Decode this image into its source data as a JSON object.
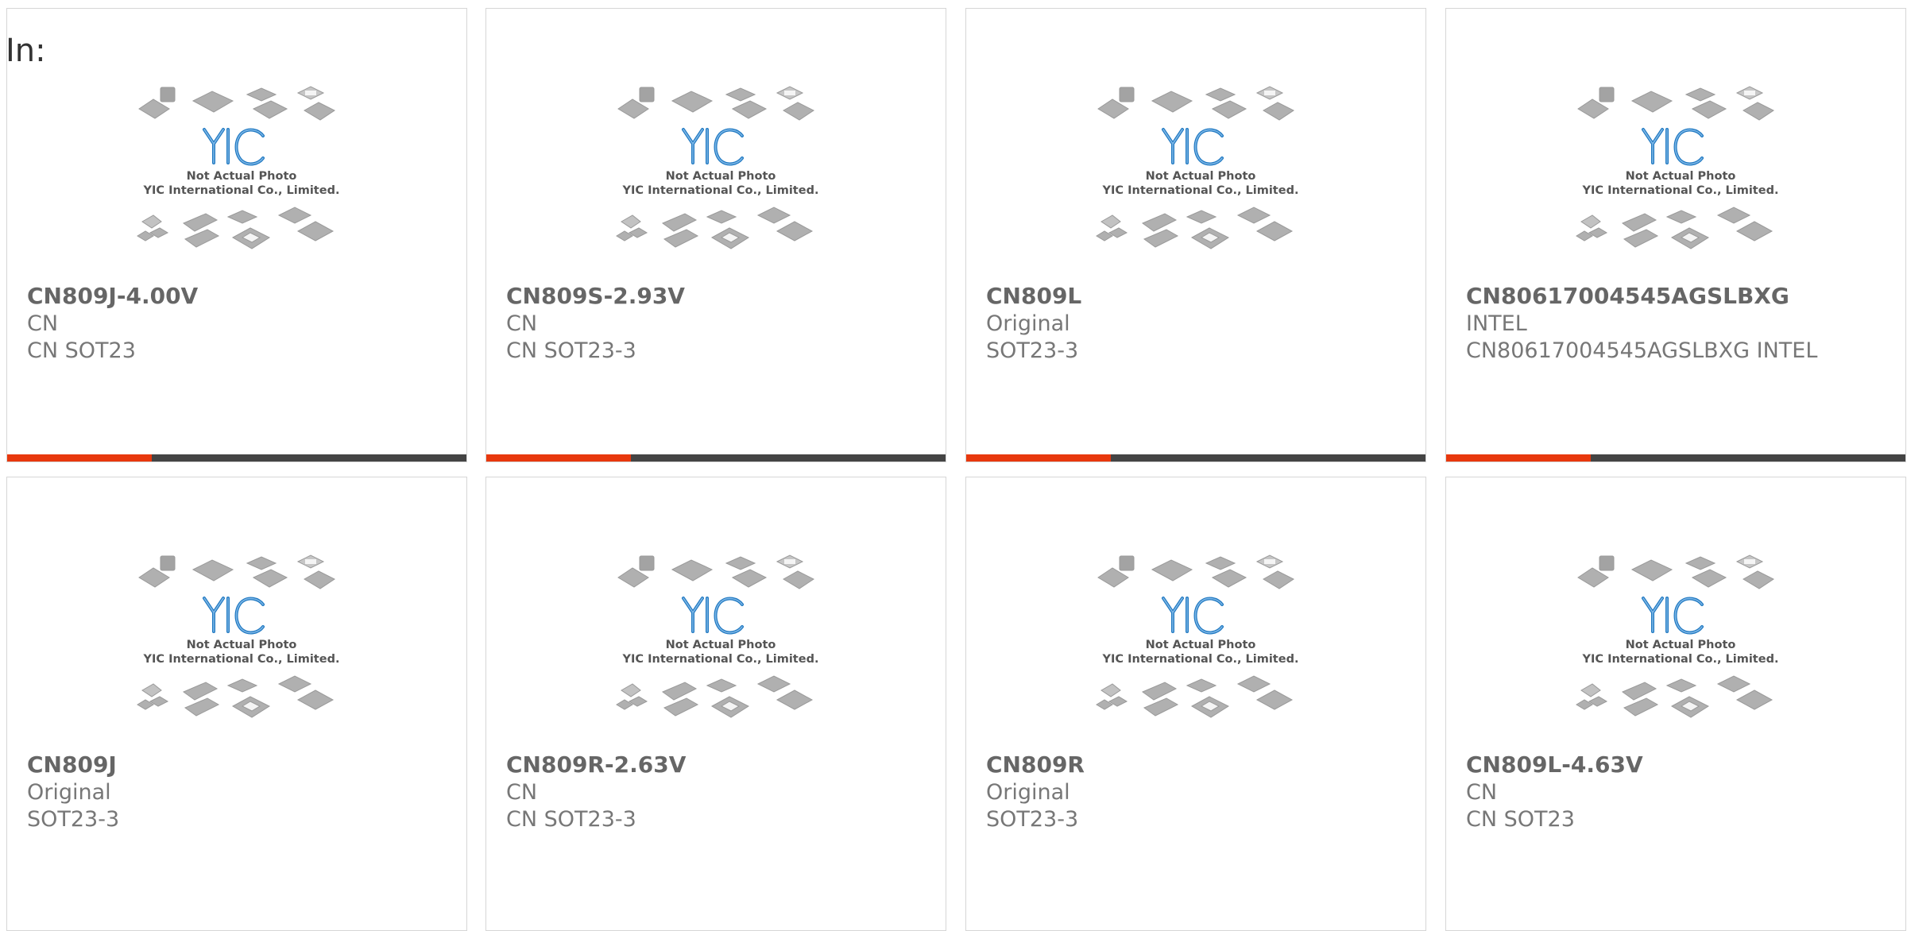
{
  "page": {
    "heading": "In:"
  },
  "colors": {
    "accent": "#e8380d",
    "bar_dark": "#444444",
    "logo_blue": "#1f78c1",
    "chip_gray": "#a6a6a6"
  },
  "placeholder": {
    "caption_line1": "Not Actual Photo",
    "caption_line2": "YIC International Co., Limited.",
    "logo_text": "YIC"
  },
  "products": [
    {
      "part": "CN809J-4.00V",
      "brand": "CN",
      "description": "CN SOT23"
    },
    {
      "part": "CN809S-2.93V",
      "brand": "CN",
      "description": "CN SOT23-3"
    },
    {
      "part": "CN809L",
      "brand": "Original",
      "description": "SOT23-3"
    },
    {
      "part": "CN80617004545AGSLBXG",
      "brand": "INTEL",
      "description": "CN80617004545AGSLBXG INTEL"
    },
    {
      "part": "CN809J",
      "brand": "Original",
      "description": "SOT23-3"
    },
    {
      "part": "CN809R-2.63V",
      "brand": "CN",
      "description": "CN SOT23-3"
    },
    {
      "part": "CN809R",
      "brand": "Original",
      "description": "SOT23-3"
    },
    {
      "part": "CN809L-4.63V",
      "brand": "CN",
      "description": "CN SOT23"
    }
  ]
}
